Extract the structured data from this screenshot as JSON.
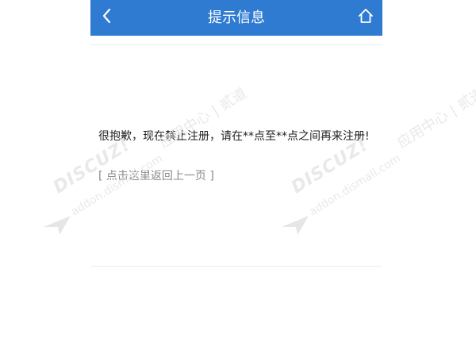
{
  "header": {
    "title": "提示信息",
    "back_icon": "chevron-left-icon",
    "home_icon": "home-icon",
    "color": "#2f7bd2"
  },
  "message": {
    "text": "很抱歉，现在禁止注册，请在**点至**点之间再来注册!",
    "link_open": "[",
    "link_text": "点击这里返回上一页",
    "link_close": "]"
  },
  "watermark": {
    "brand": "DISCUZ!",
    "cn": "应用中心 | 贰道",
    "url": "addon.dismall.com"
  }
}
